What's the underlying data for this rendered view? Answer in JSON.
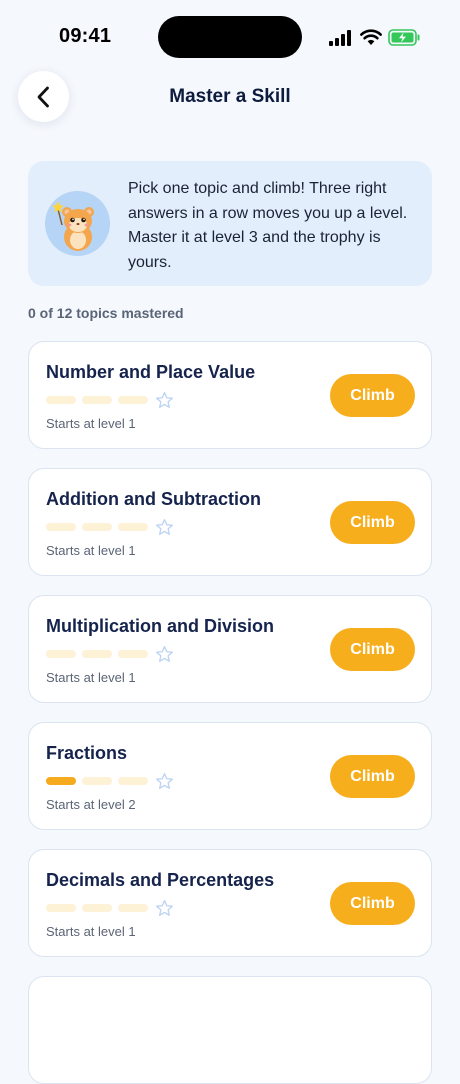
{
  "status": {
    "time": "09:41"
  },
  "header": {
    "title": "Master a Skill",
    "back_icon": "chevron-left-icon"
  },
  "info": {
    "text": "Pick one topic and climb! Three right answers in a row moves you up a level. Master it at level 3 and the trophy is yours.",
    "mascot": "hamster-mascot"
  },
  "summary": "0 of 12 topics mastered",
  "colors": {
    "accent": "#F7AE1C",
    "progress_empty": "#FDF1D6",
    "info_bg": "#E3EEFC"
  },
  "topics": [
    {
      "title": "Number and Place Value",
      "level_text": "Starts at level 1",
      "levels_filled": 0,
      "levels_total": 3,
      "button": "Climb"
    },
    {
      "title": "Addition and Subtraction",
      "level_text": "Starts at level 1",
      "levels_filled": 0,
      "levels_total": 3,
      "button": "Climb"
    },
    {
      "title": "Multiplication and Division",
      "level_text": "Starts at level 1",
      "levels_filled": 0,
      "levels_total": 3,
      "button": "Climb"
    },
    {
      "title": "Fractions",
      "level_text": "Starts at level 2",
      "levels_filled": 1,
      "levels_total": 3,
      "button": "Climb"
    },
    {
      "title": "Decimals and Percentages",
      "level_text": "Starts at level 1",
      "levels_filled": 0,
      "levels_total": 3,
      "button": "Climb"
    }
  ]
}
